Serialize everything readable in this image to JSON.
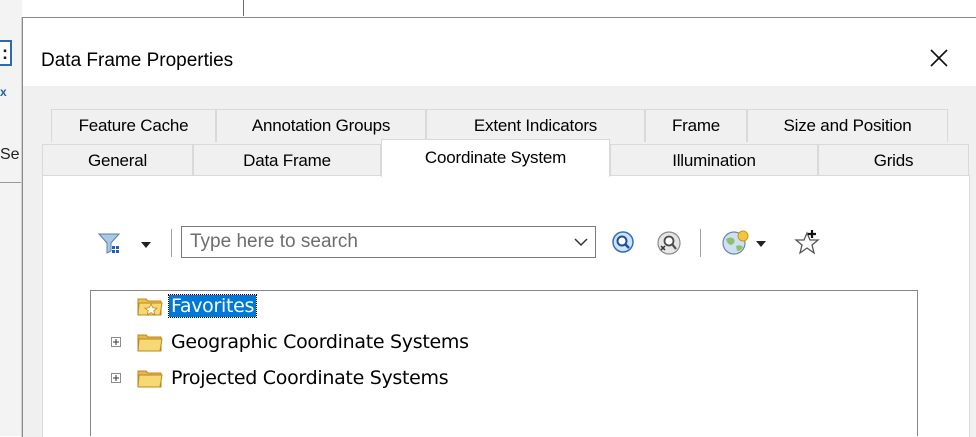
{
  "window": {
    "title": "Data Frame Properties",
    "close_glyph": "✕"
  },
  "background_fragments": {
    "left_char_top": ":",
    "left_char_mid": "x",
    "left_char_low": "Se"
  },
  "tabs_row1": [
    {
      "label": "Feature Cache"
    },
    {
      "label": "Annotation Groups"
    },
    {
      "label": "Extent Indicators"
    },
    {
      "label": "Frame"
    },
    {
      "label": "Size and Position"
    }
  ],
  "tabs_row2": [
    {
      "label": "General"
    },
    {
      "label": "Data Frame"
    },
    {
      "label": "Coordinate System",
      "active": true
    },
    {
      "label": "Illumination"
    },
    {
      "label": "Grids"
    }
  ],
  "toolbar": {
    "filter_icon": "filter-icon",
    "search_placeholder": "Type here to search",
    "search_value": "",
    "search_button_icon": "magnifier-search-icon",
    "clear_search_icon": "clear-search-icon",
    "globe_icon": "globe-add-icon",
    "favorite_icon": "add-favorite-star-icon"
  },
  "tree": {
    "items": [
      {
        "label": "Favorites",
        "icon": "favorites-folder-icon",
        "expandable": false,
        "selected": true
      },
      {
        "label": "Geographic Coordinate Systems",
        "icon": "folder-icon",
        "expandable": true,
        "selected": false
      },
      {
        "label": "Projected Coordinate Systems",
        "icon": "folder-icon",
        "expandable": true,
        "selected": false
      }
    ]
  },
  "colors": {
    "selection": "#0078d7",
    "dialog_bg": "#f0f0f0",
    "folder_yellow": "#f8d775"
  }
}
